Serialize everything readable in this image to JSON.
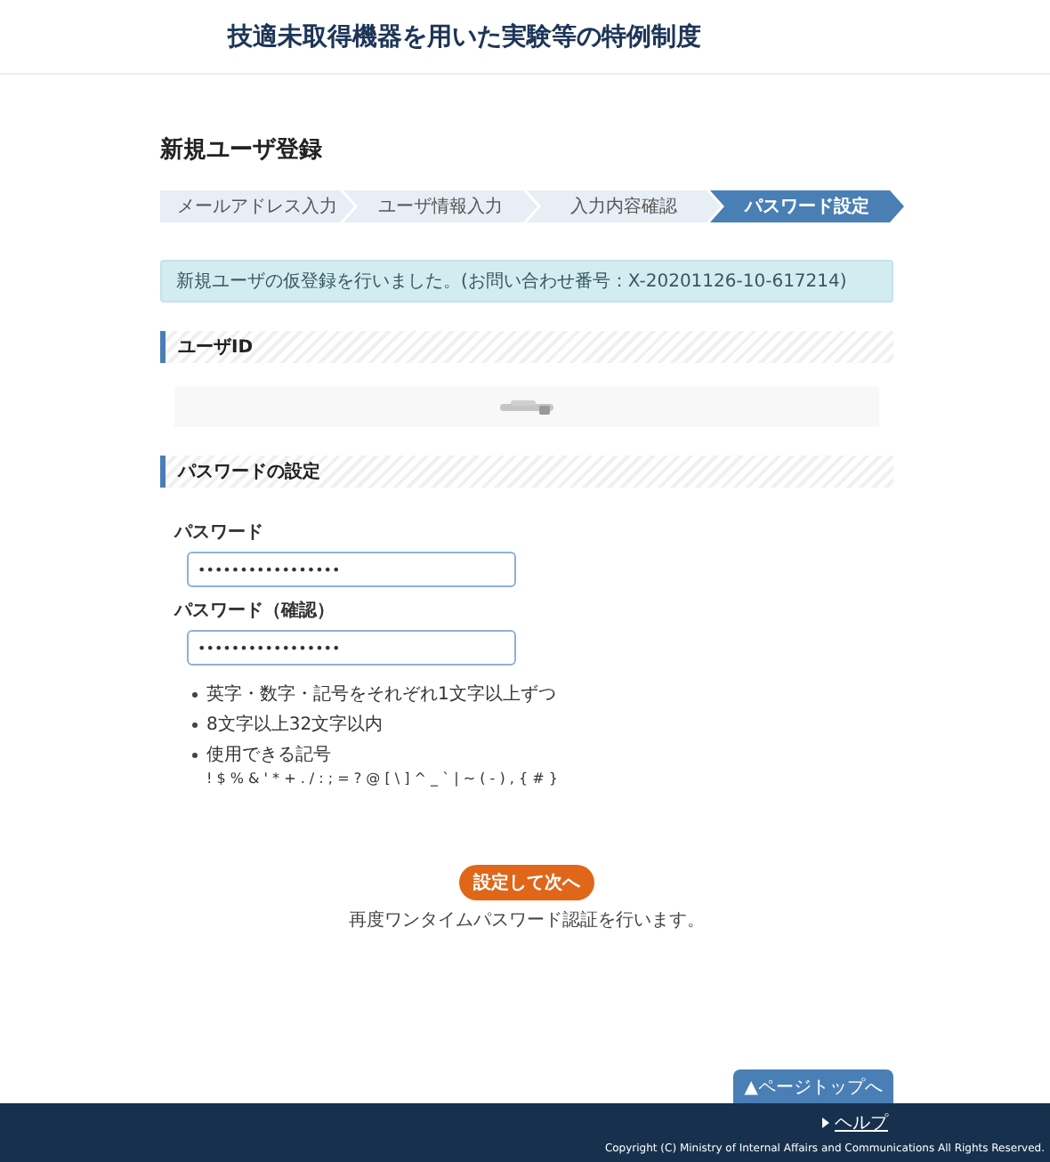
{
  "header": {
    "title": "技適未取得機器を用いた実験等の特例制度"
  },
  "page_title": "新規ユーザ登録",
  "steps": [
    {
      "label": "メールアドレス入力",
      "selected": false
    },
    {
      "label": "ユーザ情報入力",
      "selected": false
    },
    {
      "label": "入力内容確認",
      "selected": false
    },
    {
      "label": "パスワード設定",
      "selected": true
    }
  ],
  "alert": "新規ユーザの仮登録を行いました。(お問い合わせ番号：X-20201126-10-617214)",
  "user_id_section": {
    "heading": "ユーザID"
  },
  "password_section": {
    "heading": "パスワードの設定",
    "fields": [
      {
        "label": "パスワード",
        "value": "•••••••••••••••••"
      },
      {
        "label": "パスワード（確認）",
        "value": "•••••••••••••••••"
      }
    ],
    "rules": [
      {
        "text": "英字・数字・記号をそれぞれ1文字以上ずつ"
      },
      {
        "text": "8文字以上32文字以内"
      },
      {
        "text": "使用できる記号",
        "detail": "! $ % & ' * + . / : ; = ? @ [ \\ ] ^ _ ` | ~ ( - ) , { # }"
      }
    ]
  },
  "submit_button": "設定して次へ",
  "submit_note": "再度ワンタイムパスワード認証を行います。",
  "page_top_button": "▲ページトップへ",
  "footer": {
    "help_link": "ヘルプ",
    "copyright": "Copyright (C) Ministry of Internal Affairs and Communications All Rights Reserved."
  }
}
